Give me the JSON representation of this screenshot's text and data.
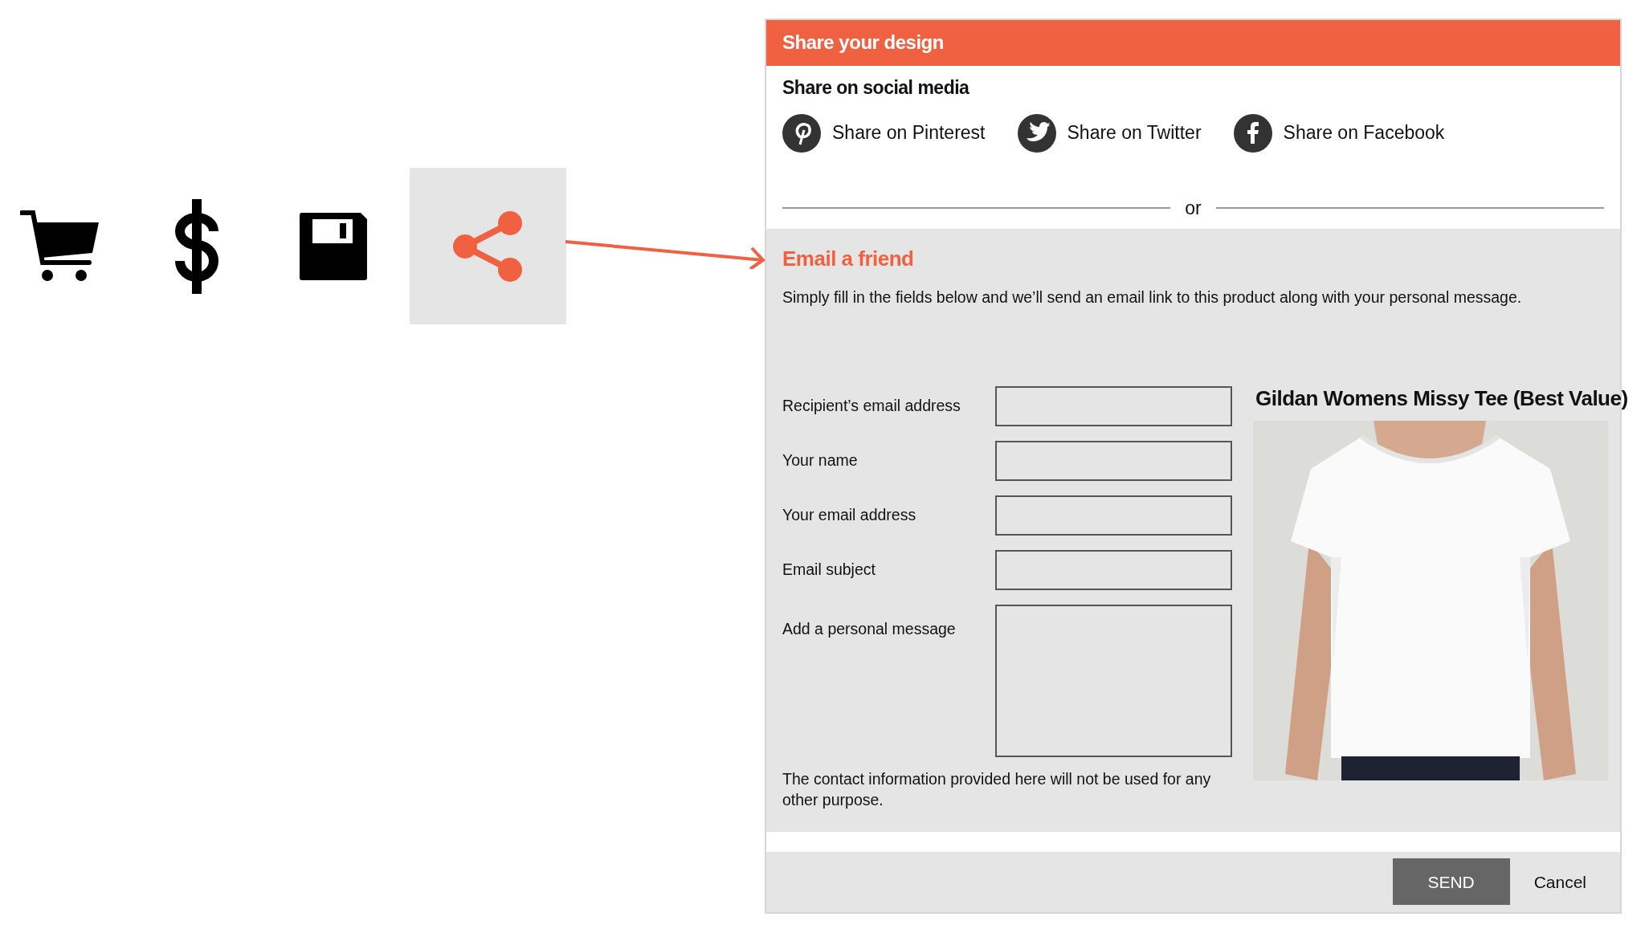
{
  "toolbar": [
    {
      "kind": "cart",
      "selected": false
    },
    {
      "kind": "dollar",
      "selected": false
    },
    {
      "kind": "save",
      "selected": false
    },
    {
      "kind": "share",
      "selected": true
    }
  ],
  "dialog": {
    "title": "Share your design",
    "social": {
      "heading": "Share on social media",
      "links": [
        {
          "kind": "pinterest",
          "label": "Share on Pinterest"
        },
        {
          "kind": "twitter",
          "label": "Share on Twitter"
        },
        {
          "kind": "facebook",
          "label": "Share on Facebook"
        }
      ],
      "divider": "or"
    },
    "email": {
      "heading": "Email a friend",
      "intro": "Simply fill in the fields below and we’ll send an email link to this product along with your personal message.",
      "fields": [
        {
          "kind": "input",
          "label": "Recipient’s email address"
        },
        {
          "kind": "input",
          "label": "Your name"
        },
        {
          "kind": "input",
          "label": "Your email address"
        },
        {
          "kind": "input",
          "label": "Email subject"
        },
        {
          "kind": "textarea",
          "label": "Add a personal message"
        }
      ],
      "note": "The contact information provided here will not be used for any other purpose.",
      "product": {
        "title": "Gildan Womens Missy Tee (Best Value)"
      }
    },
    "buttons": [
      {
        "kind": "primary",
        "label": "SEND"
      },
      {
        "kind": "link",
        "label": "Cancel"
      }
    ]
  }
}
